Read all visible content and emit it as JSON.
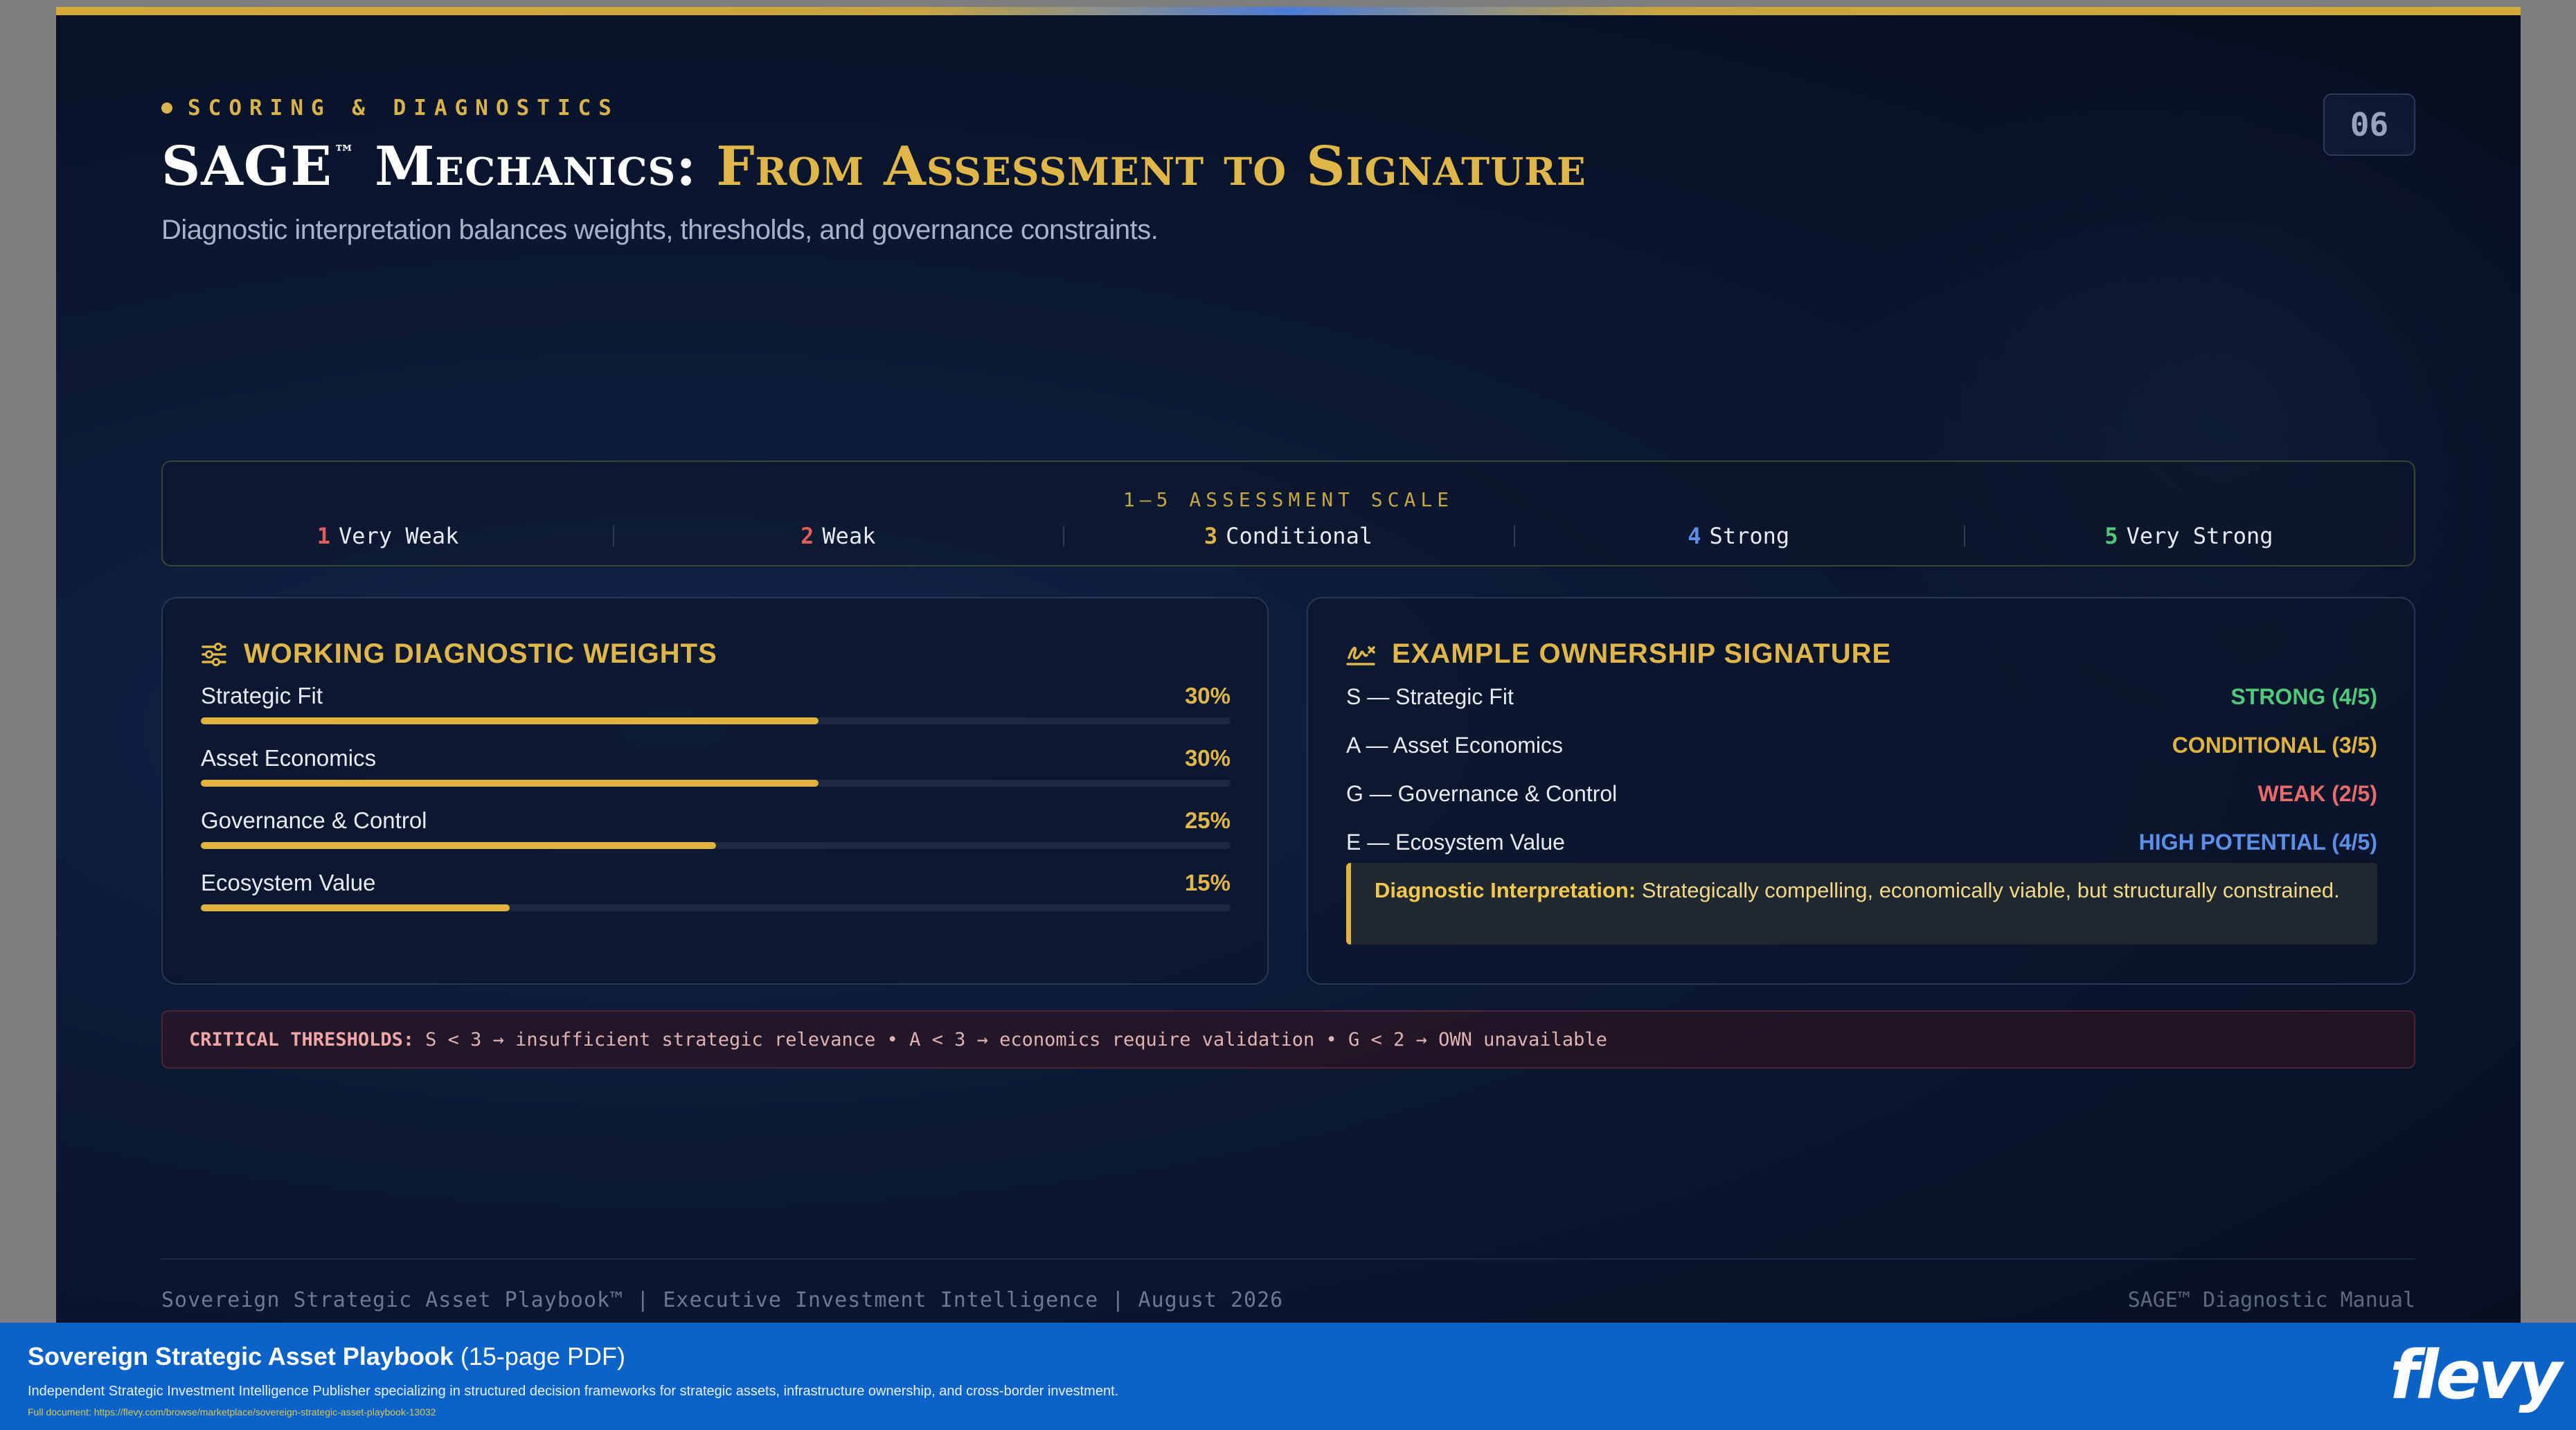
{
  "header": {
    "eyebrow": "SCORING & DIAGNOSTICS",
    "title_main": "SAGE",
    "title_tm": "™",
    "title_rest": " Mechanics:",
    "title_highlight": "From Assessment to Signature",
    "subtitle": "Diagnostic interpretation balances weights, thresholds, and governance constraints.",
    "page_number": "06"
  },
  "scale": {
    "title": "1–5 ASSESSMENT SCALE",
    "items": [
      {
        "num": "1",
        "label": "Very Weak",
        "color": "#e45b5b"
      },
      {
        "num": "2",
        "label": "Weak",
        "color": "#e45b5b"
      },
      {
        "num": "3",
        "label": "Conditional",
        "color": "#e0b23e"
      },
      {
        "num": "4",
        "label": "Strong",
        "color": "#5b8fe8"
      },
      {
        "num": "5",
        "label": "Very Strong",
        "color": "#4fc97a"
      }
    ]
  },
  "weights": {
    "heading": "WORKING DIAGNOSTIC WEIGHTS",
    "icon": "sliders-icon",
    "rows": [
      {
        "label": "Strategic Fit",
        "pct": "30%",
        "value": 0.3
      },
      {
        "label": "Asset Economics",
        "pct": "30%",
        "value": 0.3
      },
      {
        "label": "Governance & Control",
        "pct": "25%",
        "value": 0.25
      },
      {
        "label": "Ecosystem Value",
        "pct": "15%",
        "value": 0.15
      }
    ]
  },
  "signature": {
    "heading": "EXAMPLE OWNERSHIP SIGNATURE",
    "icon": "signature-icon",
    "rows": [
      {
        "label": "S — Strategic Fit",
        "value": "STRONG (4/5)",
        "color": "#4fc97a"
      },
      {
        "label": "A — Asset Economics",
        "value": "CONDITIONAL (3/5)",
        "color": "#e0b23e"
      },
      {
        "label": "G — Governance & Control",
        "value": "WEAK (2/5)",
        "color": "#e86a6a"
      },
      {
        "label": "E — Ecosystem Value",
        "value": "HIGH POTENTIAL (4/5)",
        "color": "#5b8fe8"
      }
    ],
    "interpretation_label": "Diagnostic Interpretation:",
    "interpretation_text": " Strategically compelling, economically viable, but structurally constrained."
  },
  "thresholds": {
    "label": "CRITICAL THRESHOLDS:",
    "text": "S < 3 → insufficient strategic relevance • A < 3 → economics require validation • G < 2 → OWN unavailable"
  },
  "footer": {
    "left": "Sovereign Strategic Asset Playbook™ | Executive Investment Intelligence | August 2026",
    "right": "SAGE™ Diagnostic Manual"
  },
  "banner": {
    "title_bold": "Sovereign Strategic Asset Playbook",
    "title_rest": " (15-page PDF)",
    "description": "Independent Strategic Investment Intelligence Publisher specializing in structured decision frameworks for strategic assets, infrastructure ownership, and cross-border investment.",
    "link": "Full document: https://flevy.com/browse/marketplace/sovereign-strategic-asset-playbook-13032",
    "logo": "flevy"
  }
}
